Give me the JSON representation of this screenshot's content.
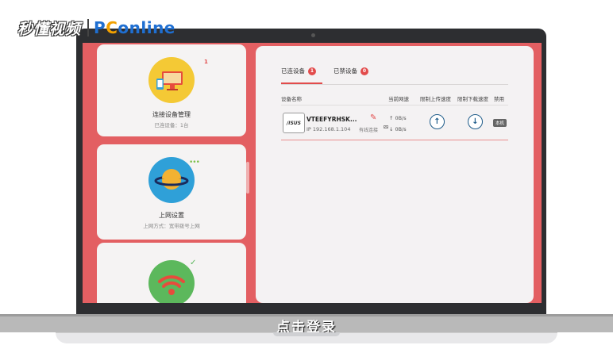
{
  "watermark": {
    "brand_cn": "秒懂视频",
    "brand_en_p": "P",
    "brand_en_c": "C",
    "brand_en_rest": "online"
  },
  "sidebar": {
    "cards": [
      {
        "title": "连接设备管理",
        "subtitle": "已连设备：1台",
        "badge": "1",
        "icon": "connected-devices-icon"
      },
      {
        "title": "上网设置",
        "subtitle": "上网方式：宽带拨号上网",
        "icon": "planet-internet-icon"
      },
      {
        "title": "",
        "subtitle": "",
        "icon": "wifi-icon"
      }
    ]
  },
  "tabs": [
    {
      "label": "已连设备",
      "count": "1"
    },
    {
      "label": "已禁设备",
      "count": "0"
    }
  ],
  "table": {
    "headers": [
      "设备名称",
      "当前网速",
      "限制上传速度",
      "限制下载速度",
      "禁用"
    ],
    "rows": [
      {
        "logo_text": "/ISUS",
        "name": "VTEEFYRHSK...",
        "ip": "IP 192.168.1.104",
        "connection": "有线连接",
        "upload_speed": "↑ 0B/s",
        "download_speed": "↓ 0B/s",
        "local_tag": "本机"
      }
    ]
  },
  "subtitle": "点击登录",
  "colors": {
    "accent": "#e24b4b",
    "panel_bg": "#e35f62",
    "button_blue": "#1f5c8a"
  }
}
